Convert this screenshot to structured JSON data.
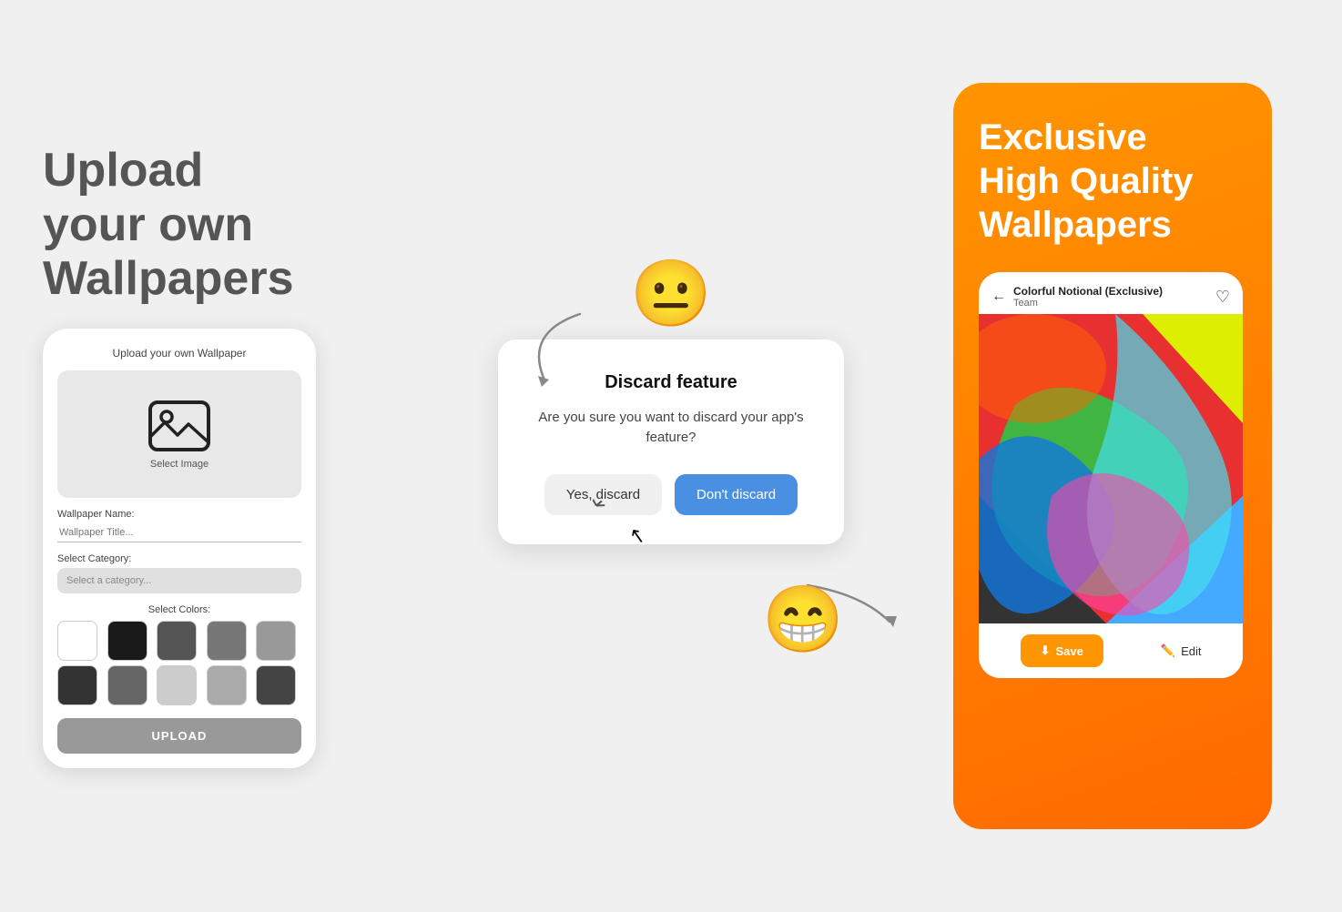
{
  "left": {
    "title": "Upload\nyour own\nWallpapers",
    "phone": {
      "header": "Upload your own Wallpaper",
      "select_image_label": "Select Image",
      "wallpaper_name_label": "Wallpaper Name:",
      "wallpaper_placeholder": "Wallpaper Title...",
      "select_category_label": "Select Category:",
      "select_category_placeholder": "Select a category...",
      "select_colors_label": "Select Colors:",
      "upload_btn": "UPLOAD",
      "colors": [
        "#ffffff",
        "#1a1a1a",
        "#555555",
        "#777777",
        "#999999",
        "#333333",
        "#666666",
        "#cccccc",
        "#aaaaaa",
        "#444444"
      ]
    }
  },
  "middle": {
    "dialog": {
      "title": "Discard feature",
      "text": "Are you sure you want to discard your app's feature?",
      "btn_yes": "Yes, discard",
      "btn_no": "Don't discard"
    }
  },
  "right": {
    "title": "Exclusive\nHigh Quality\nWallpapers",
    "phone": {
      "back_label": "←",
      "wallpaper_name": "Colorful Notional (Exclusive)",
      "team_label": "Team",
      "save_btn": "Save",
      "edit_btn": "Edit"
    }
  }
}
